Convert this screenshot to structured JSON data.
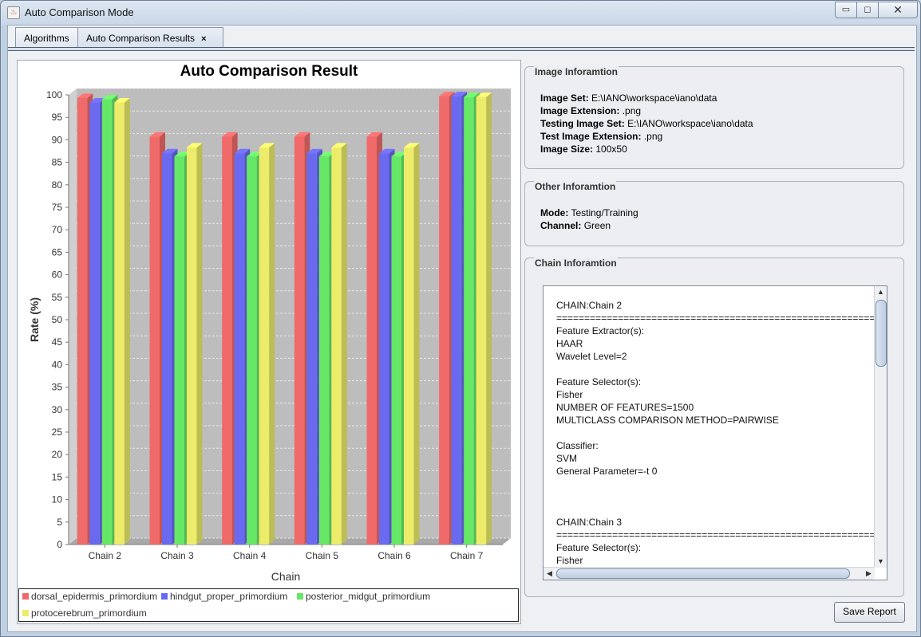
{
  "window": {
    "title": "Auto Comparison Mode",
    "icon": "java-cup-icon",
    "controls": {
      "minimize": "▭",
      "maximize": "◻",
      "close": "✕"
    }
  },
  "tabs": [
    {
      "label": "Algorithms",
      "active": false
    },
    {
      "label": "Auto Comparison Results",
      "active": true,
      "close": "×"
    }
  ],
  "chart_data": {
    "type": "bar",
    "title": "Auto Comparison Result",
    "xlabel": "Chain",
    "ylabel": "Rate (%)",
    "ylim": [
      0,
      100
    ],
    "yticks": [
      0,
      5,
      10,
      15,
      20,
      25,
      30,
      35,
      40,
      45,
      50,
      55,
      60,
      65,
      70,
      75,
      80,
      85,
      90,
      95,
      100
    ],
    "categories": [
      "Chain 2",
      "Chain 3",
      "Chain 4",
      "Chain 5",
      "Chain 6",
      "Chain 7"
    ],
    "series": [
      {
        "name": "dorsal_epidermis_primordium",
        "color": "#f06a6a",
        "values": [
          99.3,
          90.7,
          90.7,
          90.7,
          90.7,
          99.7
        ]
      },
      {
        "name": "hindgut_proper_primordium",
        "color": "#6a6af0",
        "values": [
          98.3,
          87.0,
          87.0,
          87.0,
          87.0,
          99.7
        ]
      },
      {
        "name": "posterior_midgut_primordium",
        "color": "#66e866",
        "values": [
          99.0,
          86.3,
          86.3,
          86.3,
          86.3,
          99.5
        ]
      },
      {
        "name": "protocerebrum_primordium",
        "color": "#ecec6a",
        "values": [
          98.3,
          88.3,
          88.3,
          88.3,
          88.3,
          99.5
        ]
      }
    ],
    "grid": true,
    "legend": "bottom"
  },
  "image_info": {
    "title": "Image Inforamtion",
    "rows": [
      {
        "key": "Image Set:",
        "value": "E:\\IANO\\workspace\\iano\\data"
      },
      {
        "key": "Image Extension:",
        "value": ".png"
      },
      {
        "key": "Testing Image Set:",
        "value": "E:\\IANO\\workspace\\iano\\data"
      },
      {
        "key": "Test Image Extension:",
        "value": ".png"
      },
      {
        "key": "Image Size:",
        "value": "100x50"
      }
    ]
  },
  "other_info": {
    "title": "Other Inforamtion",
    "rows": [
      {
        "key": "Mode:",
        "value": "Testing/Training"
      },
      {
        "key": "Channel:",
        "value": "Green"
      }
    ]
  },
  "chain_info": {
    "title": "Chain Inforamtion",
    "text": "CHAIN:Chain 2\n=====================================================================\nFeature Extractor(s):\nHAAR\nWavelet Level=2\n\nFeature Selector(s):\nFisher\nNUMBER OF FEATURES=1500\nMULTICLASS COMPARISON METHOD=PAIRWISE\n\nClassifier:\nSVM\nGeneral Parameter=-t 0\n\n\n\nCHAIN:Chain 3\n=====================================================================\nFeature Selector(s):\nFisher"
  },
  "buttons": {
    "save_report": "Save Report"
  }
}
